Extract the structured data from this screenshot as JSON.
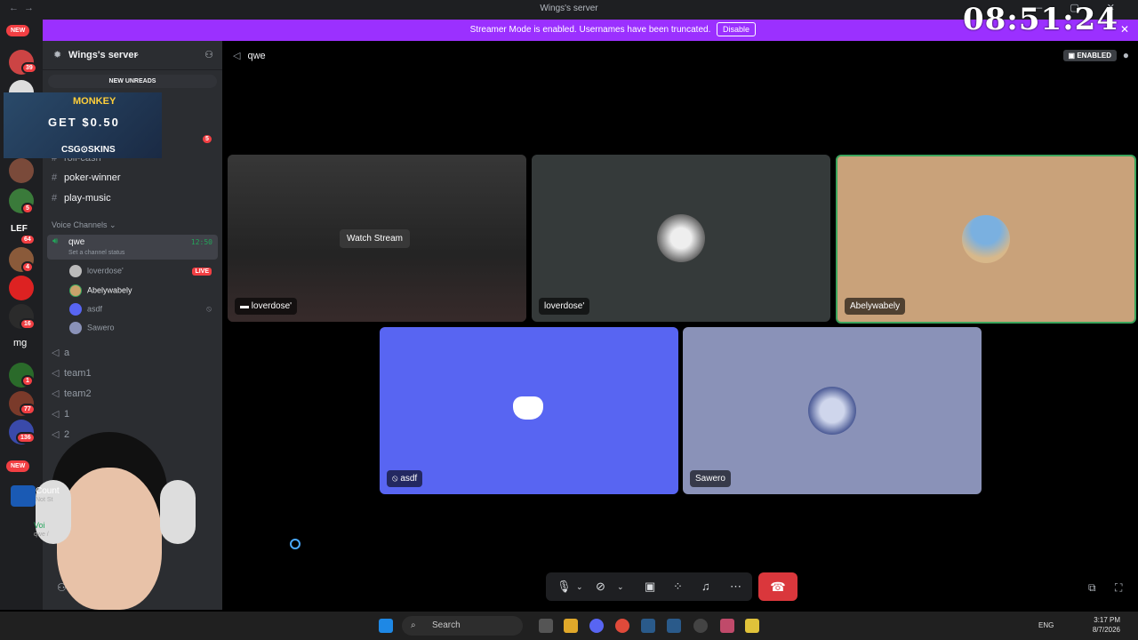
{
  "window": {
    "title": "Wings's server",
    "nav_back": "←",
    "nav_fwd": "→"
  },
  "banner": {
    "message": "Streamer Mode is enabled. Usernames have been truncated.",
    "disable_label": "Disable",
    "close": "✕"
  },
  "overlay_clock": "08:51:24",
  "server_rail": {
    "new_top": "NEW",
    "new_bottom": "NEW",
    "badges": [
      "39",
      "5",
      "64",
      "4",
      "16",
      "1",
      "77",
      "136"
    ],
    "lef_label": "LEF",
    "mg_label": "mg"
  },
  "sidebar": {
    "server_name": "Wings's server",
    "new_unreads": "NEW UNREADS",
    "unread_badge": "5",
    "promo": {
      "monkey": "MONKEY",
      "get": "GET $0.50",
      "brand": "CSG⊙SKINS"
    },
    "text_channels": [
      {
        "name": "roll-cash"
      },
      {
        "name": "poker-winner"
      },
      {
        "name": "play-music"
      }
    ],
    "voice_category": "Voice Channels",
    "active_voice": {
      "name": "qwe",
      "status": "Set a channel status",
      "time": "12:50"
    },
    "voice_users": [
      {
        "name": "loverdose'",
        "live": "LIVE"
      },
      {
        "name": "Abelywabely"
      },
      {
        "name": "asdf"
      },
      {
        "name": "Sawero"
      }
    ],
    "voice_channels": [
      "a",
      "team1",
      "team2",
      "1",
      "2"
    ],
    "now_playing": {
      "game": "Count",
      "sub": "Not St"
    },
    "voice_panel": {
      "label": "Voi",
      "sub": "qwe /"
    }
  },
  "main": {
    "channel": "qwe",
    "enabled_label": "ENABLED",
    "watch_stream": "Watch Stream",
    "tiles": [
      {
        "label": "loverdose'"
      },
      {
        "label": "loverdose'"
      },
      {
        "label": "Abelywabely"
      },
      {
        "label": "asdf"
      },
      {
        "label": "Sawero"
      }
    ]
  },
  "controls": {
    "icons": [
      "microphone-icon",
      "camera-off-icon",
      "screen-share-icon",
      "activities-icon",
      "soundboard-icon",
      "more-icon",
      "hang-up-icon"
    ]
  },
  "taskbar": {
    "search": "Search",
    "lang": "ENG",
    "time": "3:17 PM",
    "date": "8/7/2026"
  }
}
